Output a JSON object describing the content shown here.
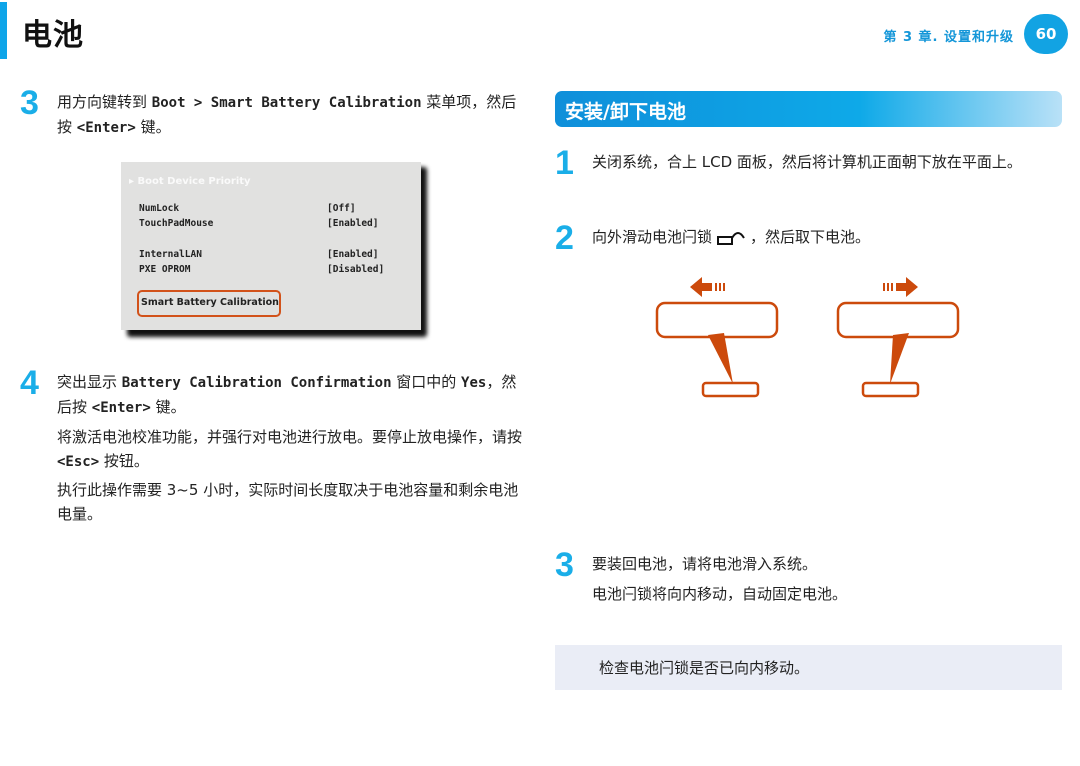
{
  "header": {
    "title": "电池",
    "chapter": "第 3 章. 设置和升级",
    "page_number": "60",
    "accent_color": "#0ea5e9"
  },
  "left": {
    "step3": {
      "number": "3",
      "text_a": "用方向键转到 ",
      "mono_a": "Boot > Smart Battery Calibration",
      "text_b": " 菜单项，然后按 ",
      "mono_b": "<Enter>",
      "text_c": " 键。"
    },
    "bios": {
      "header": "Boot Device Priority",
      "rows": [
        {
          "label": "NumLock",
          "value": "[Off]"
        },
        {
          "label": "TouchPadMouse",
          "value": "[Enabled]"
        },
        {
          "label": "InternalLAN",
          "value": "[Enabled]"
        },
        {
          "label": "PXE OPROM",
          "value": "[Disabled]"
        }
      ],
      "selected": "Smart Battery Calibration",
      "highlight_color": "#d2521a"
    },
    "step4": {
      "number": "4",
      "text_a": "突出显示 ",
      "mono_a": "Battery Calibration Confirmation",
      "text_b": " 窗口中的 ",
      "mono_b": "Yes",
      "text_c": "，然后按 ",
      "mono_c": "<Enter>",
      "text_d": " 键。"
    },
    "para1_a": "将激活电池校准功能，并强行对电池进行放电。要停止放电操作，请按 ",
    "para1_mono": "<Esc>",
    "para1_b": " 按钮。",
    "para2": "执行此操作需要 3~5 小时，实际时间长度取决于电池容量和剩余电池电量。"
  },
  "right": {
    "section_title": "安装/卸下电池",
    "step1": {
      "number": "1",
      "text": "关闭系统，合上 LCD 面板，然后将计算机正面朝下放在平面上。"
    },
    "step2": {
      "number": "2",
      "text_a": "向外滑动电池闩锁",
      "icon": "lock-open-icon",
      "text_b": "，然后取下电池。"
    },
    "illustration": {
      "color": "#cc4a0c",
      "left_arrow": "arrow-left",
      "right_arrow": "arrow-right"
    },
    "step3": {
      "number": "3",
      "line1": "要装回电池，请将电池滑入系统。",
      "line2": "电池闩锁将向内移动，自动固定电池。"
    },
    "note": "检查电池闩锁是否已向内移动。"
  }
}
